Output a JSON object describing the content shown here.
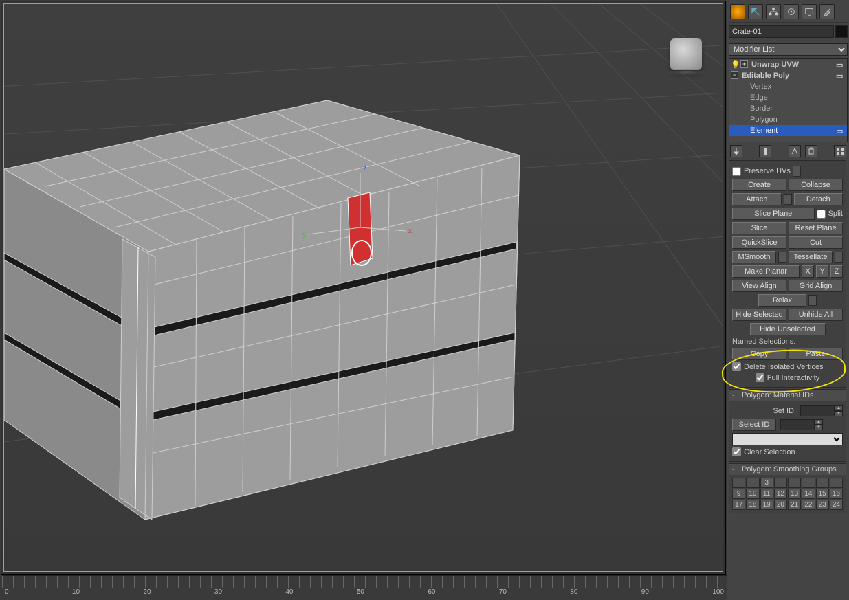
{
  "object_name": "Crate-01",
  "modifier_list_label": "Modifier List",
  "stack": {
    "unwrap": "Unwrap UVW",
    "editpoly": "Editable Poly",
    "subs": [
      "Vertex",
      "Edge",
      "Border",
      "Polygon",
      "Element"
    ],
    "selected": "Element"
  },
  "edit": {
    "preserve_uvs": "Preserve UVs",
    "create": "Create",
    "collapse": "Collapse",
    "attach": "Attach",
    "detach": "Detach",
    "slice_plane": "Slice Plane",
    "split": "Split",
    "slice": "Slice",
    "reset_plane": "Reset Plane",
    "quickslice": "QuickSlice",
    "cut": "Cut",
    "msmooth": "MSmooth",
    "tessellate": "Tessellate",
    "make_planar": "Make Planar",
    "x": "X",
    "y": "Y",
    "z": "Z",
    "view_align": "View Align",
    "grid_align": "Grid Align",
    "relax": "Relax",
    "hide_selected": "Hide Selected",
    "unhide_all": "Unhide All",
    "hide_unselected": "Hide Unselected",
    "named_selections": "Named Selections:",
    "copy": "Copy",
    "paste": "Paste",
    "delete_iso": "Delete Isolated Vertices",
    "full_interact": "Full Interactivity"
  },
  "matids": {
    "title": "Polygon: Material IDs",
    "set_id": "Set ID:",
    "select_id": "Select ID",
    "clear_sel": "Clear Selection"
  },
  "smoothing": {
    "title": "Polygon: Smoothing Groups"
  },
  "sg_numbers": [
    "",
    "",
    "3",
    "",
    "",
    "",
    "",
    "",
    "9",
    "10",
    "11",
    "12",
    "13",
    "14",
    "15",
    "16",
    "17",
    "18",
    "19",
    "20",
    "21",
    "22",
    "23",
    "24"
  ],
  "timeline_labels": [
    "0",
    "10",
    "20",
    "30",
    "40",
    "50",
    "60",
    "70",
    "80",
    "90",
    "100"
  ],
  "axis": {
    "x": "x",
    "y": "y",
    "z": "z"
  }
}
